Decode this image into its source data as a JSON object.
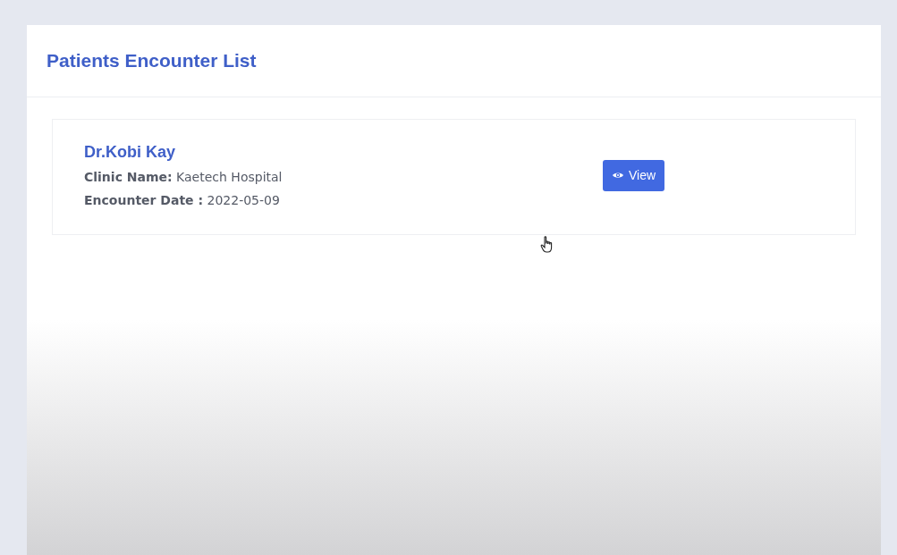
{
  "page": {
    "title": "Patients Encounter List"
  },
  "encounters": [
    {
      "doctor": "Dr.Kobi Kay",
      "clinic_label": "Clinic Name:",
      "clinic": "Kaetech Hospital",
      "date_label": "Encounter Date :",
      "date": "2022-05-09",
      "button": "View"
    }
  ]
}
